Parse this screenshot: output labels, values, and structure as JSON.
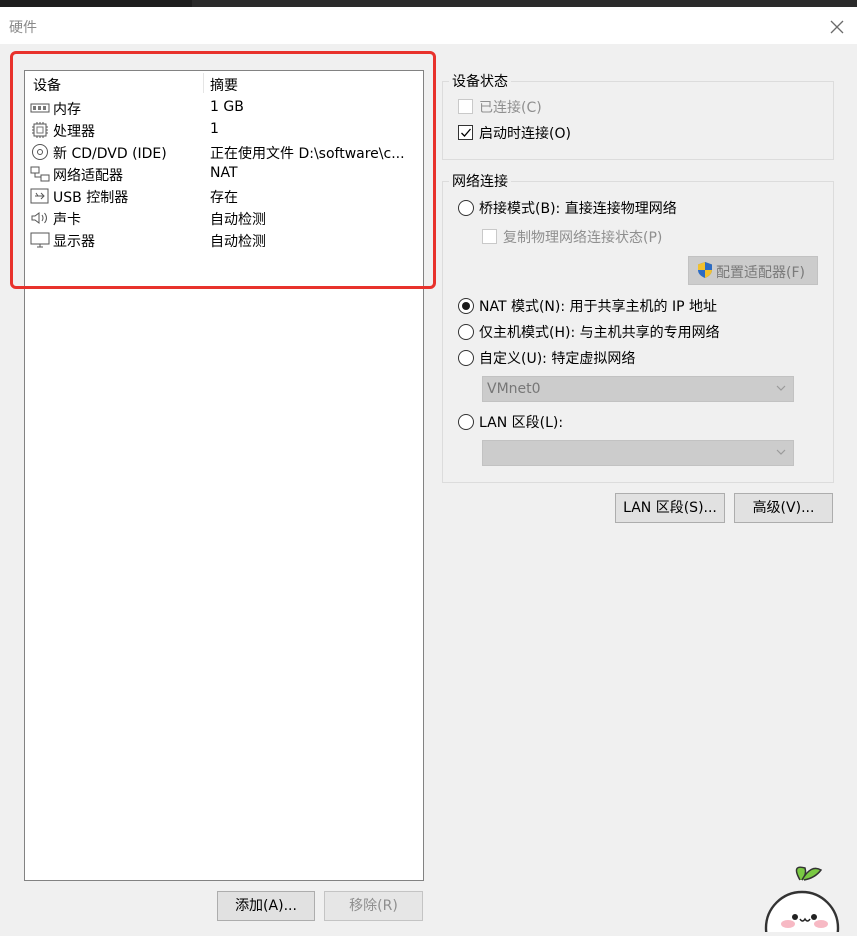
{
  "window": {
    "title": "硬件"
  },
  "device_list": {
    "headers": {
      "device": "设备",
      "summary": "摘要"
    },
    "items": [
      {
        "icon": "memory-icon",
        "name": "内存",
        "summary": "1 GB"
      },
      {
        "icon": "processor-icon",
        "name": "处理器",
        "summary": "1"
      },
      {
        "icon": "cd-dvd-icon",
        "name": "新 CD/DVD (IDE)",
        "summary": "正在使用文件 D:\\software\\c..."
      },
      {
        "icon": "network-adapter-icon",
        "name": "网络适配器",
        "summary": "NAT"
      },
      {
        "icon": "usb-icon",
        "name": "USB 控制器",
        "summary": "存在"
      },
      {
        "icon": "sound-card-icon",
        "name": "声卡",
        "summary": "自动检测"
      },
      {
        "icon": "display-icon",
        "name": "显示器",
        "summary": "自动检测"
      }
    ]
  },
  "buttons": {
    "add": "添加(A)...",
    "remove": "移除(R)",
    "lan_segments": "LAN 区段(S)...",
    "advanced": "高级(V)..."
  },
  "device_status": {
    "title": "设备状态",
    "connected": {
      "label": "已连接(C)",
      "checked": false,
      "enabled": false
    },
    "connect_at_power_on": {
      "label": "启动时连接(O)",
      "checked": true,
      "enabled": true
    }
  },
  "network_connection": {
    "title": "网络连接",
    "bridged": "桥接模式(B): 直接连接物理网络",
    "replicate": "复制物理网络连接状态(P)",
    "configure_adapters": "配置适配器(F)",
    "nat": "NAT 模式(N): 用于共享主机的 IP 地址",
    "host_only": "仅主机模式(H): 与主机共享的专用网络",
    "custom": "自定义(U): 特定虚拟网络",
    "custom_select_value": "VMnet0",
    "lan_segment": "LAN 区段(L):",
    "lan_segment_select_value": "",
    "selected": "nat"
  },
  "colors": {
    "highlight_border": "#e8322c",
    "window_bg": "#f0f0f0",
    "disabled_text": "#8f8f8f",
    "disabled_fill": "#cccccc"
  }
}
